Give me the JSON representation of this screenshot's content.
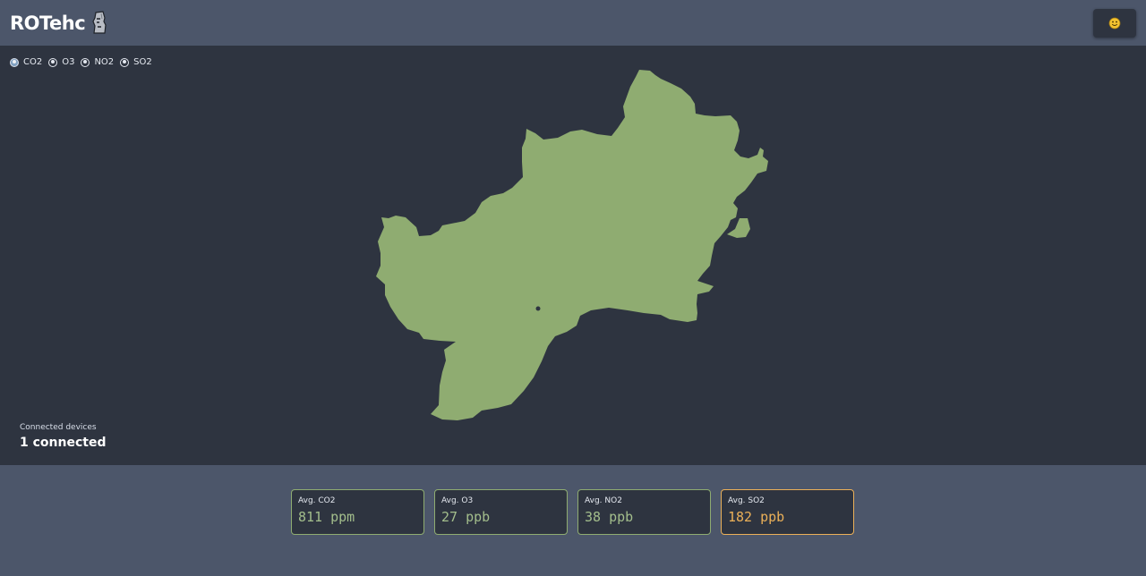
{
  "app": {
    "title": "ROTehc",
    "logo_icon": "moai-icon",
    "user_icon": "smiley-icon"
  },
  "pollutants": {
    "selected": "CO2",
    "options": [
      {
        "label": "CO2"
      },
      {
        "label": "O3"
      },
      {
        "label": "NO2"
      },
      {
        "label": "SO2"
      }
    ]
  },
  "map": {
    "region_color": "#8fac71",
    "background_color": "#2e3440",
    "device_marker": "device-dot"
  },
  "devices": {
    "label": "Connected devices",
    "count": "1 connected"
  },
  "stats": [
    {
      "label": "Avg. CO2",
      "value": "811 ppm",
      "status": "ok"
    },
    {
      "label": "Avg. O3",
      "value": "27 ppb",
      "status": "ok"
    },
    {
      "label": "Avg. NO2",
      "value": "38 ppb",
      "status": "ok"
    },
    {
      "label": "Avg. SO2",
      "value": "182 ppb",
      "status": "warning"
    }
  ],
  "colors": {
    "ok": "#a3be8c",
    "warning": "#ebb058"
  }
}
